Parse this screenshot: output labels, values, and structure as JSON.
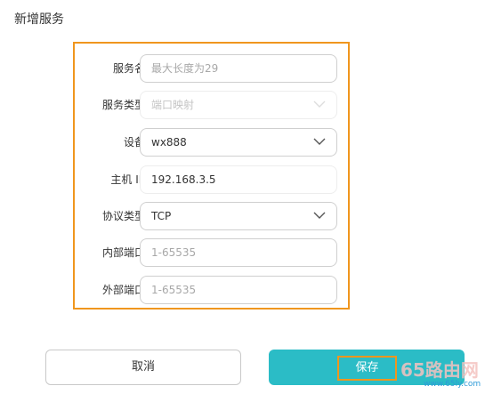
{
  "page": {
    "title": "新增服务"
  },
  "form": {
    "service_name": {
      "label": "服务名",
      "value": "",
      "placeholder": "最大长度为29"
    },
    "service_type": {
      "label": "服务类型",
      "value": "端口映射"
    },
    "device": {
      "label": "设备",
      "value": "wx888"
    },
    "host_ip": {
      "label": "主机 IP",
      "value": "192.168.3.5"
    },
    "protocol": {
      "label": "协议类型",
      "value": "TCP"
    },
    "internal_port": {
      "label": "内部端口",
      "value": "",
      "placeholder": "1-65535"
    },
    "external_port": {
      "label": "外部端口",
      "value": "",
      "placeholder": "1-65535"
    }
  },
  "buttons": {
    "cancel": "取消",
    "save": "保存"
  },
  "watermark": {
    "brand": "65路由网",
    "url": "www.65ly.com"
  },
  "colors": {
    "accent": "#2bbcc6",
    "highlight": "#f0961e",
    "border": "#cfcfcf",
    "watermark_text": "#f4c2bf",
    "watermark_url": "#2f9bd8"
  },
  "icons": {
    "select_arrow": "chevron-down-icon"
  }
}
